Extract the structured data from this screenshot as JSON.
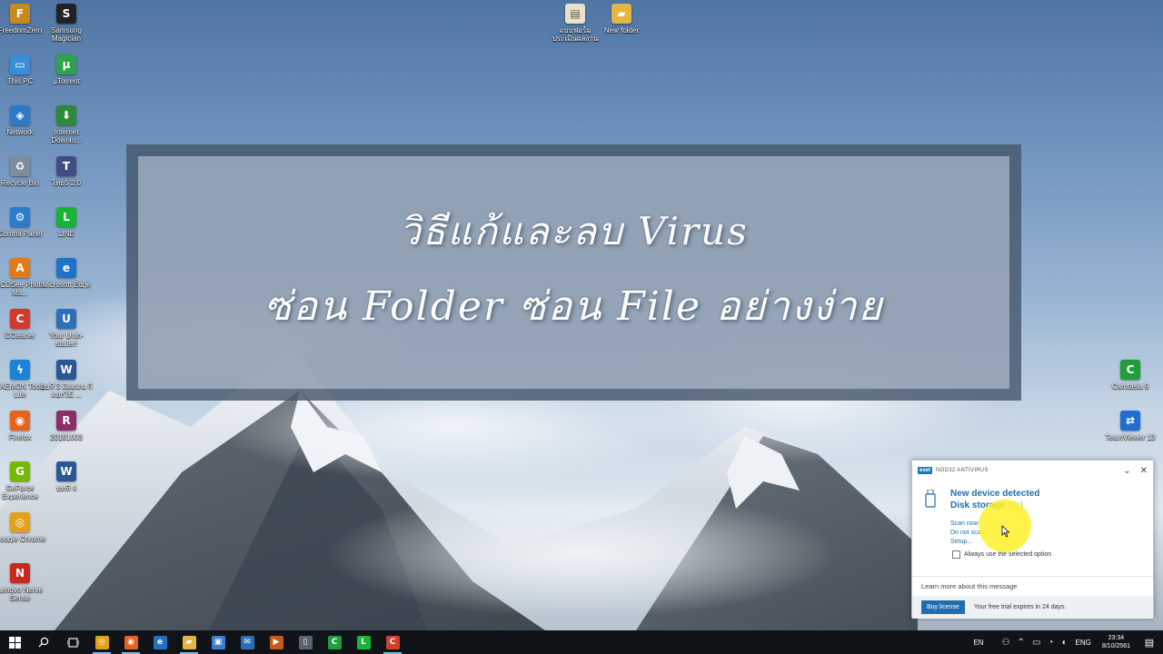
{
  "desktop": {
    "icons": [
      {
        "label": "FreedomZero",
        "icon": "freedomzero-icon",
        "glyph": "F",
        "color": "#c98a1d"
      },
      {
        "label": "Samsung Magician",
        "icon": "samsung-magician-icon",
        "glyph": "S",
        "color": "#222222"
      },
      {
        "label": "This PC",
        "icon": "this-pc-icon",
        "glyph": "▭",
        "color": "#3a8ed8"
      },
      {
        "label": "µTorrent",
        "icon": "utorrent-icon",
        "glyph": "µ",
        "color": "#2fa34a"
      },
      {
        "label": "Network",
        "icon": "network-icon",
        "glyph": "◈",
        "color": "#2d79c7"
      },
      {
        "label": "Internet Downlo...",
        "icon": "internet-download-manager-icon",
        "glyph": "⬇",
        "color": "#2c8a3a"
      },
      {
        "label": "Recycle Bin",
        "icon": "recycle-bin-icon",
        "glyph": "♻",
        "color": "#7f8c99"
      },
      {
        "label": "ไทย5 2.0",
        "icon": "thai5-icon",
        "glyph": "T",
        "color": "#444c88"
      },
      {
        "label": "Control Panel",
        "icon": "control-panel-icon",
        "glyph": "⚙",
        "color": "#2a7cc8"
      },
      {
        "label": "LINE",
        "icon": "line-icon",
        "glyph": "L",
        "color": "#17b436"
      },
      {
        "label": "ACDSee Photo Ma...",
        "icon": "acdsee-icon",
        "glyph": "A",
        "color": "#e27a16"
      },
      {
        "label": "Microsoft Edge",
        "icon": "edge-icon",
        "glyph": "e",
        "color": "#1e73c8"
      },
      {
        "label": "CCleaner",
        "icon": "ccleaner-icon",
        "glyph": "C",
        "color": "#d4382c"
      },
      {
        "label": "Your Unin-staller!",
        "icon": "your-uninstaller-icon",
        "glyph": "U",
        "color": "#2f6eb8"
      },
      {
        "label": "DAEMON Tools Lite",
        "icon": "daemon-tools-icon",
        "glyph": "ϟ",
        "color": "#1c84d6"
      },
      {
        "label": "อบที่ 3 ติดตอน กี่ ดอกไม้ ...",
        "icon": "word-document-icon",
        "glyph": "W",
        "color": "#2b5797"
      },
      {
        "label": "Firefox",
        "icon": "firefox-icon",
        "glyph": "◉",
        "color": "#e5631d"
      },
      {
        "label": "20181003",
        "icon": "winrar-icon",
        "glyph": "R",
        "color": "#8b2d68"
      },
      {
        "label": "GeForce Experience",
        "icon": "geforce-icon",
        "glyph": "G",
        "color": "#76b900"
      },
      {
        "label": "บทที่ 4",
        "icon": "word-document-icon",
        "glyph": "W",
        "color": "#2b5797"
      },
      {
        "label": "Google Chrome",
        "icon": "chrome-icon",
        "glyph": "◎",
        "color": "#e0a11b"
      },
      {
        "label": "Lenovo Nerve Sense",
        "icon": "lenovo-nerve-sense-icon",
        "glyph": "N",
        "color": "#c8281e"
      }
    ],
    "top_icons": [
      {
        "label": "แบบฟอร์ม ประเมินผลงาน",
        "icon": "document-icon",
        "glyph": "▤",
        "color": "#e9e2c8"
      },
      {
        "label": "New folder",
        "icon": "folder-icon",
        "glyph": "▰",
        "color": "#e3b542"
      }
    ],
    "right_icons": [
      {
        "label": "Camtasia 9",
        "icon": "camtasia-icon",
        "glyph": "C",
        "color": "#1f9e3b"
      },
      {
        "label": "TeamViewer 13",
        "icon": "teamviewer-icon",
        "glyph": "⇄",
        "color": "#1f6fd1"
      }
    ]
  },
  "banner": {
    "line1": "วิธีแก้และลบ Virus",
    "line2": "ซ่อน Folder ซ่อน File อย่างง่าย"
  },
  "eset": {
    "product": "NOD32 ANTIVIRUS",
    "logo": "eset",
    "title": "New device detected",
    "device": "Disk storage",
    "drive": "(G:)",
    "scan_now": "Scan now",
    "do_not_scan": "Do not scan",
    "setup": "Setup...",
    "always_use": "Always use the selected option",
    "learn_more": "Learn more about this message",
    "buy_license": "Buy license",
    "trial": "Your free trial expires in 24 days."
  },
  "taskbar": {
    "apps": [
      {
        "icon": "chrome-icon",
        "glyph": "◎",
        "color": "#e0a11b"
      },
      {
        "icon": "firefox-icon",
        "glyph": "◉",
        "color": "#e5631d"
      },
      {
        "icon": "edge-icon",
        "glyph": "e",
        "color": "#1e73c8"
      },
      {
        "icon": "file-explorer-icon",
        "glyph": "▰",
        "color": "#e3b542"
      },
      {
        "icon": "store-icon",
        "glyph": "▣",
        "color": "#3b7fd0"
      },
      {
        "icon": "mail-icon",
        "glyph": "✉",
        "color": "#2d6fb7"
      },
      {
        "icon": "media-icon",
        "glyph": "▶",
        "color": "#c25c16"
      },
      {
        "icon": "text-editor-icon",
        "glyph": "▯",
        "color": "#5a6470"
      },
      {
        "icon": "camtasia-icon",
        "glyph": "C",
        "color": "#1f9e3b"
      },
      {
        "icon": "line-icon",
        "glyph": "L",
        "color": "#17b436"
      },
      {
        "icon": "camtasia-recorder-icon",
        "glyph": "C",
        "color": "#d1402a"
      }
    ],
    "language": "EN",
    "input_lang": "ENG",
    "time": "23:34",
    "date": "8/10/2561"
  }
}
